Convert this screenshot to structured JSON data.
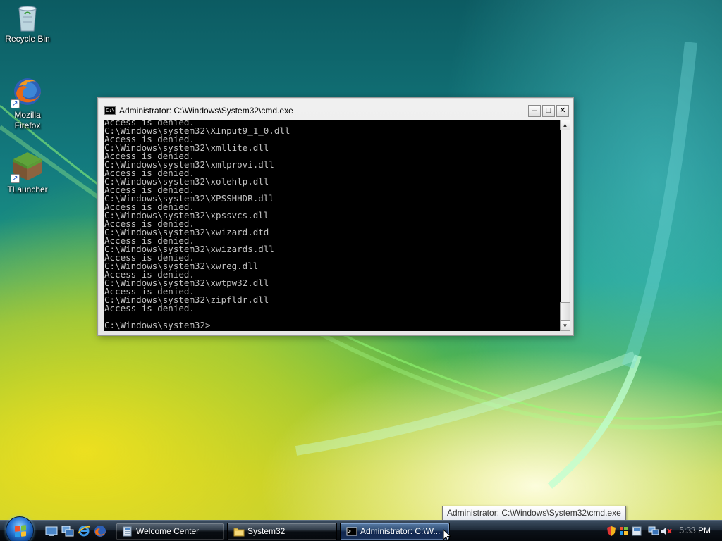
{
  "desktop": {
    "icons": [
      {
        "label_line1": "Recycle Bin",
        "label_line2": ""
      },
      {
        "label_line1": "Mozilla",
        "label_line2": "Firefox"
      },
      {
        "label_line1": "TLauncher",
        "label_line2": ""
      }
    ]
  },
  "cmd_window": {
    "title": "Administrator: C:\\Windows\\System32\\cmd.exe",
    "title_icon_text": "C:\\",
    "lines": [
      "Access is denied.",
      "C:\\Windows\\system32\\XInput9_1_0.dll",
      "Access is denied.",
      "C:\\Windows\\system32\\xmllite.dll",
      "Access is denied.",
      "C:\\Windows\\system32\\xmlprovi.dll",
      "Access is denied.",
      "C:\\Windows\\system32\\xolehlp.dll",
      "Access is denied.",
      "C:\\Windows\\system32\\XPSSHHDR.dll",
      "Access is denied.",
      "C:\\Windows\\system32\\xpssvcs.dll",
      "Access is denied.",
      "C:\\Windows\\system32\\xwizard.dtd",
      "Access is denied.",
      "C:\\Windows\\system32\\xwizards.dll",
      "Access is denied.",
      "C:\\Windows\\system32\\xwreg.dll",
      "Access is denied.",
      "C:\\Windows\\system32\\xwtpw32.dll",
      "Access is denied.",
      "C:\\Windows\\system32\\zipfldr.dll",
      "Access is denied.",
      "",
      "C:\\Windows\\system32>"
    ],
    "buttons": {
      "minimize": "–",
      "maximize": "□",
      "close": "✕"
    }
  },
  "tooltip": {
    "text": "Administrator: C:\\Windows\\System32\\cmd.exe"
  },
  "taskbar": {
    "buttons": [
      {
        "label": "Welcome Center",
        "icon": "welcome-center-icon"
      },
      {
        "label": "System32",
        "icon": "folder-icon"
      },
      {
        "label": "Administrator: C:\\W...",
        "icon": "cmd-icon"
      }
    ],
    "clock": "5:33 PM"
  }
}
